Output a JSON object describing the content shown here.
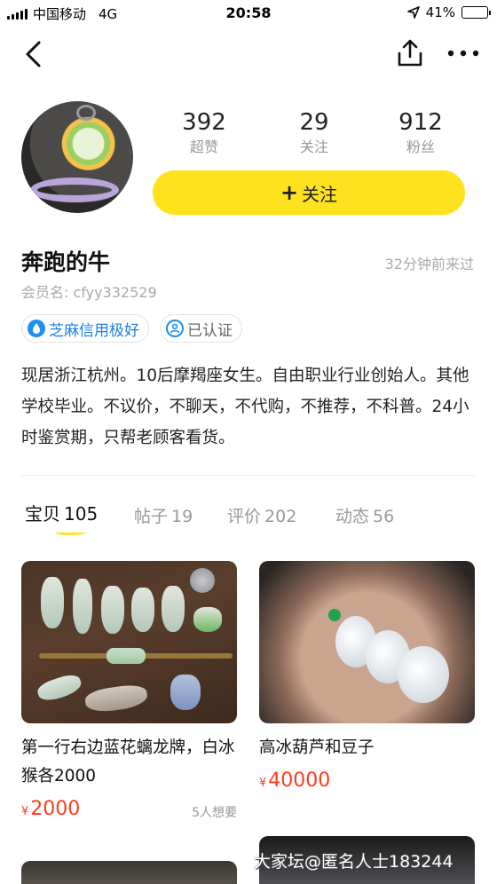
{
  "status_bar": {
    "carrier": "中国移动",
    "network": "4G",
    "time": "20:58",
    "battery": "41%",
    "battery_level": 0.41
  },
  "profile": {
    "stats": [
      {
        "value": "392",
        "label": "超赞"
      },
      {
        "value": "29",
        "label": "关注"
      },
      {
        "value": "912",
        "label": "粉丝"
      }
    ],
    "follow_label": "关注",
    "name": "奔跑的牛",
    "last_seen": "32分钟前来过",
    "member_id": "会员名: cfyy332529",
    "badges": {
      "zhima": "芝麻信用极好",
      "certified": "已认证"
    },
    "bio": "现居浙江杭州。10后摩羯座女生。自由职业行业创始人。其他学校毕业。不议价，不聊天，不代购，不推荐，不科普。24小时鉴赏期，只帮老顾客看货。"
  },
  "tabs": [
    {
      "label": "宝贝",
      "count": "105",
      "active": true
    },
    {
      "label": "帖子",
      "count": "19",
      "active": false
    },
    {
      "label": "评价",
      "count": "202",
      "active": false
    },
    {
      "label": "动态",
      "count": "56",
      "active": false
    }
  ],
  "items": [
    {
      "title": "第一行右边蓝花螭龙牌，白冰猴各2000",
      "currency": "¥",
      "price": "2000",
      "wants": "5人想要"
    },
    {
      "title": "高冰葫芦和豆子",
      "currency": "¥",
      "price": "40000",
      "wants": ""
    }
  ],
  "watermark": "大家坛@匿名人士183244",
  "colors": {
    "accent": "#ffe21e",
    "price": "#ff3b1f",
    "zhima": "#1f7fe5"
  },
  "icons": [
    "back-icon",
    "share-icon",
    "more-icon",
    "zhima-icon",
    "verified-icon"
  ]
}
